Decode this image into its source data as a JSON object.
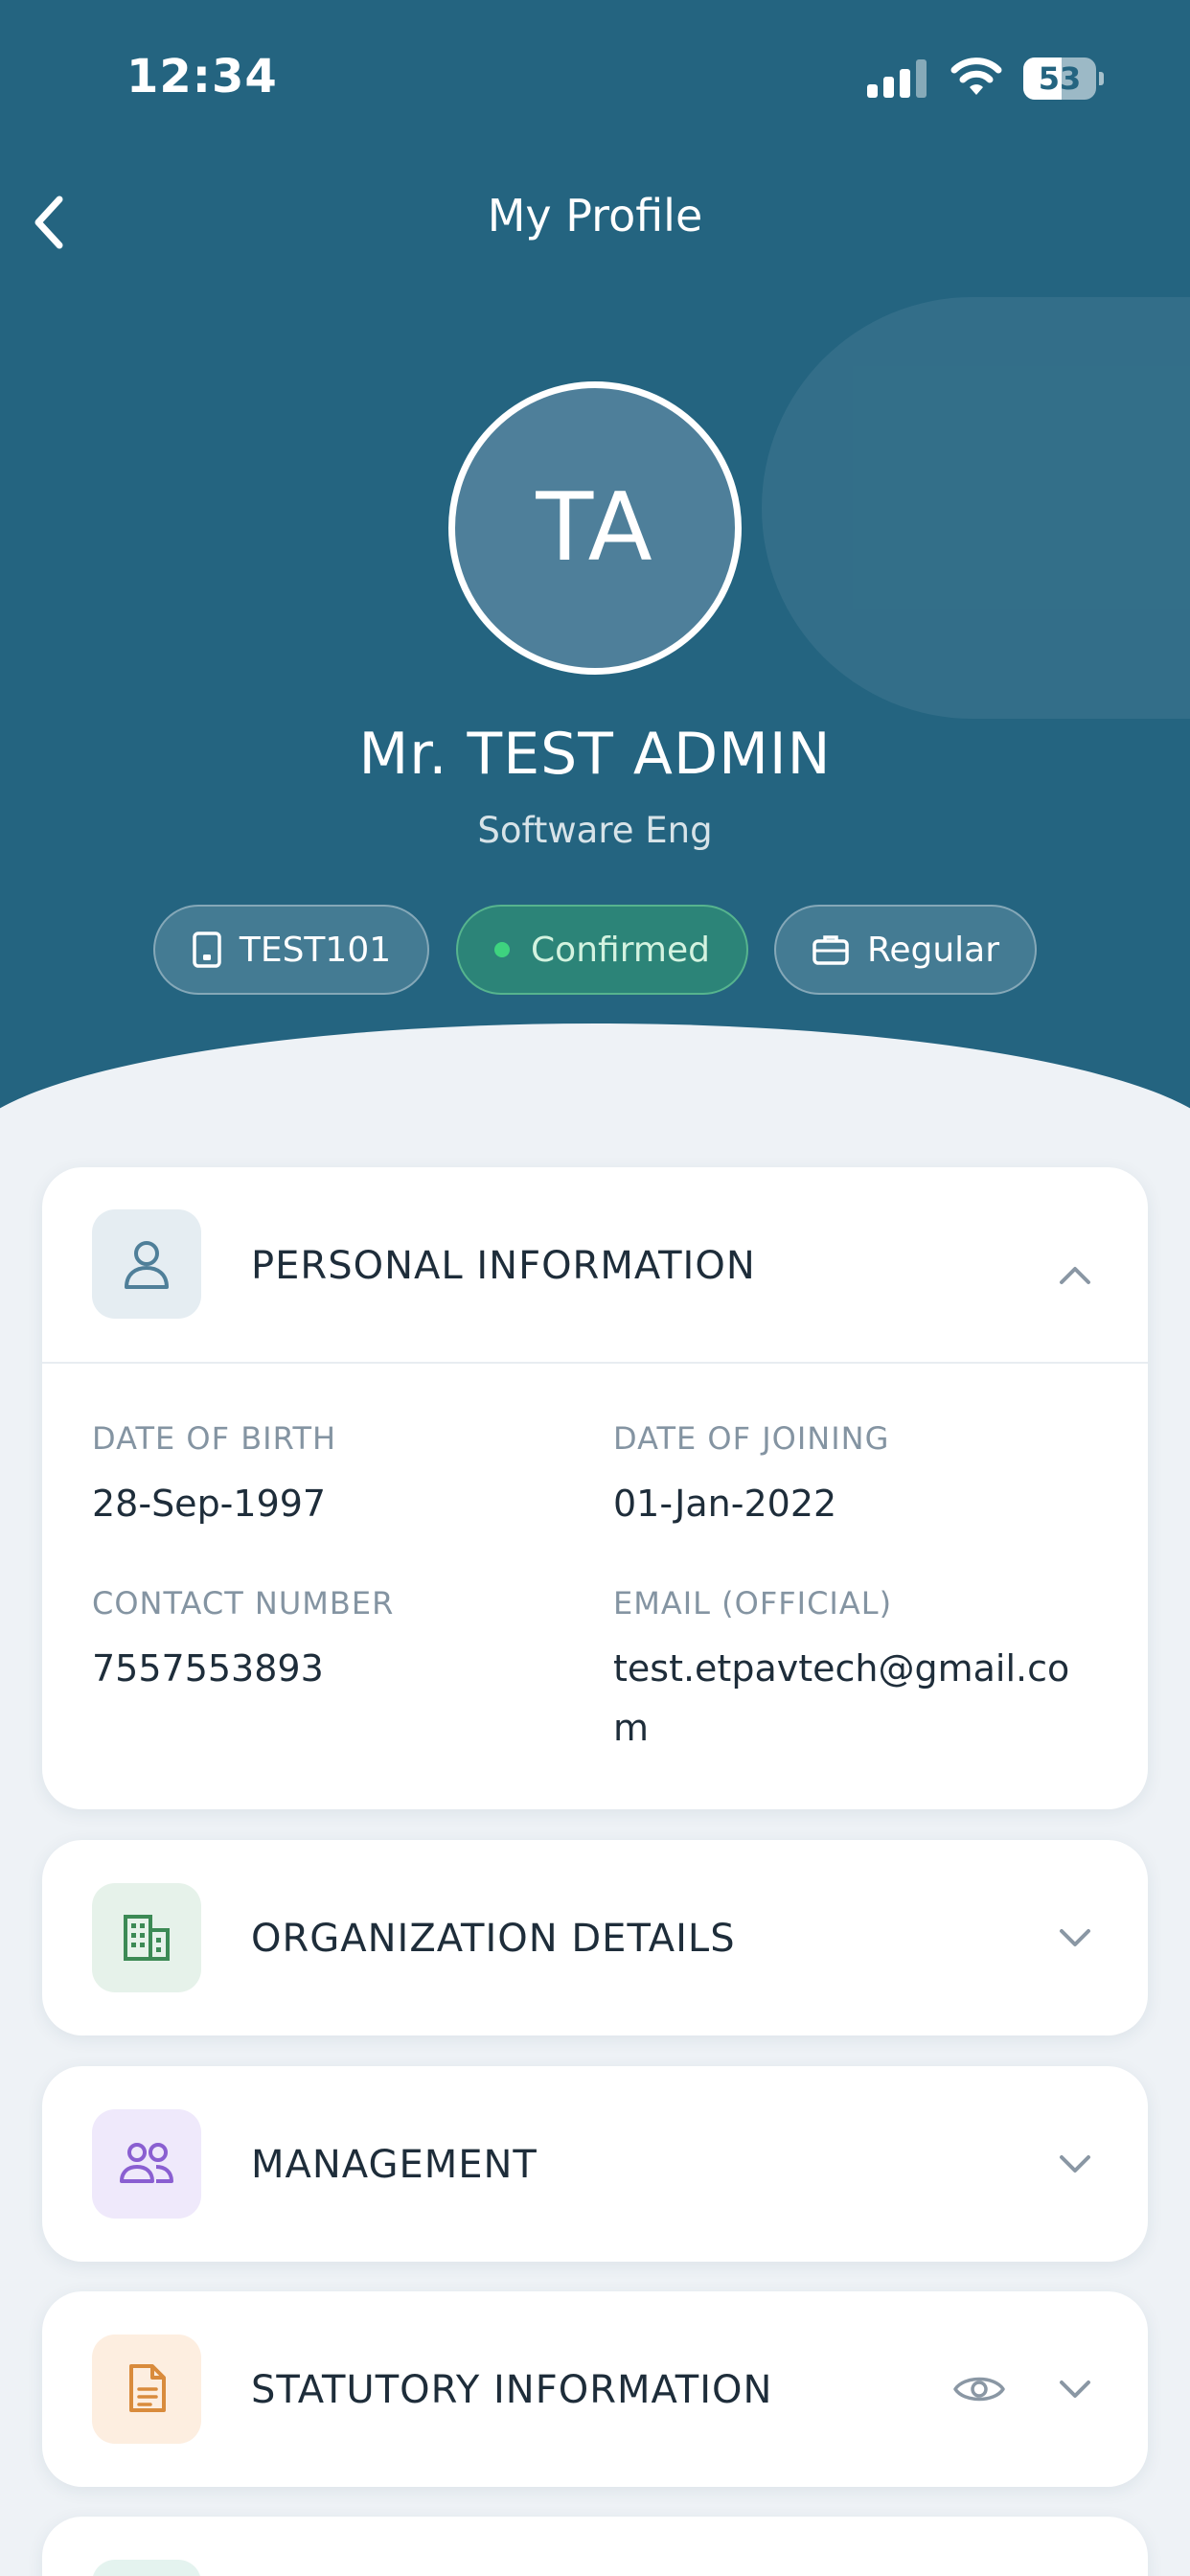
{
  "status_bar": {
    "time": "12:34",
    "battery": "53",
    "battery_level": 0.53
  },
  "nav": {
    "title": "My Profile",
    "back_icon": "chevron-left-icon"
  },
  "profile": {
    "initials": "TA",
    "name": "Mr. TEST ADMIN",
    "designation": "Software Eng",
    "chips": {
      "employee_id": "TEST101",
      "status": "Confirmed",
      "employment_type": "Regular"
    }
  },
  "sections": {
    "personal": {
      "title": "PERSONAL INFORMATION",
      "icon": "user-icon",
      "expanded": true,
      "fields": {
        "dob_label": "DATE OF BIRTH",
        "dob_value": "28-Sep-1997",
        "doj_label": "DATE OF JOINING",
        "doj_value": "01-Jan-2022",
        "contact_label": "CONTACT NUMBER",
        "contact_value": "7557553893",
        "email_label": "EMAIL (OFFICIAL)",
        "email_value_line1": "test.etpavtech@gmail.co",
        "email_value_line2": "m"
      }
    },
    "organization": {
      "title": "ORGANIZATION DETAILS",
      "icon": "building-icon"
    },
    "management": {
      "title": "MANAGEMENT",
      "icon": "users-icon"
    },
    "statutory": {
      "title": "STATUTORY INFORMATION",
      "icon": "document-icon"
    }
  },
  "colors": {
    "header_bg": "#246480",
    "page_bg": "#eef2f6",
    "confirmed_green": "#3ed37f",
    "text_dark": "#1e2d3a",
    "label_gray": "#8494a2"
  }
}
